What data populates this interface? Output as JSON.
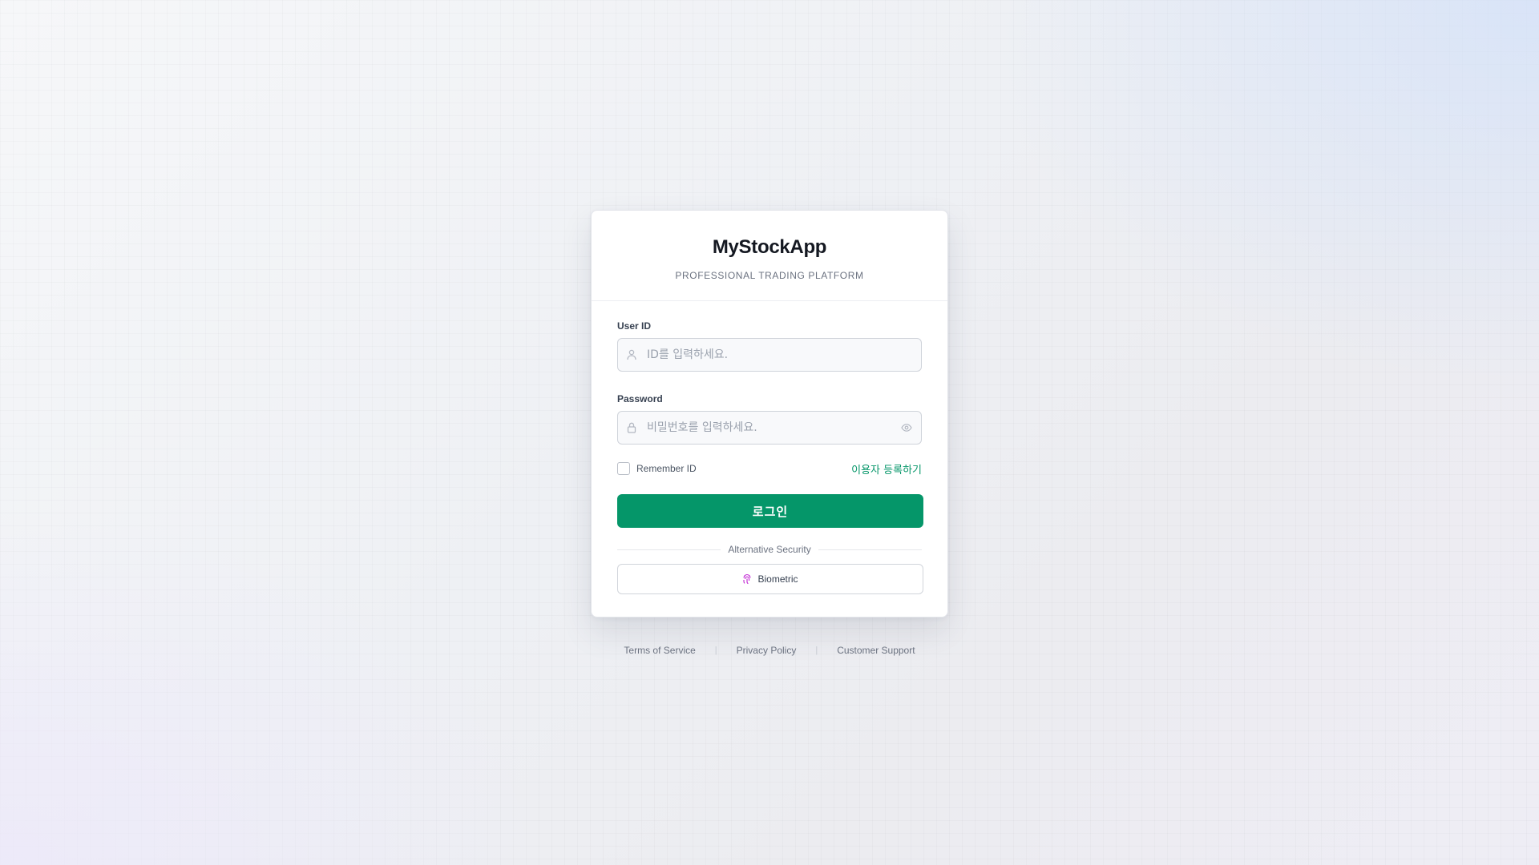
{
  "app": {
    "title": "MyStockApp",
    "subtitle": "PROFESSIONAL TRADING PLATFORM"
  },
  "form": {
    "user_id": {
      "label": "User ID",
      "value": "",
      "placeholder": "ID를 입력하세요.",
      "icon": "user-icon"
    },
    "password": {
      "label": "Password",
      "value": "",
      "placeholder": "비밀번호를 입력하세요.",
      "icon": "lock-icon",
      "toggle_icon": "eye-icon"
    },
    "remember_label": "Remember ID",
    "remember_checked": false,
    "register_link": "이용자 등록하기",
    "login_button": "로그인",
    "divider_text": "Alternative Security",
    "biometric_button": "Biometric",
    "biometric_icon": "fingerprint-icon"
  },
  "footer": {
    "links": [
      "Terms of Service",
      "Privacy Policy",
      "Customer Support"
    ],
    "separator": "|"
  },
  "colors": {
    "accent": "#059669",
    "title": "#141821",
    "muted": "#6b7280",
    "biometric_icon": "#c026d3"
  }
}
